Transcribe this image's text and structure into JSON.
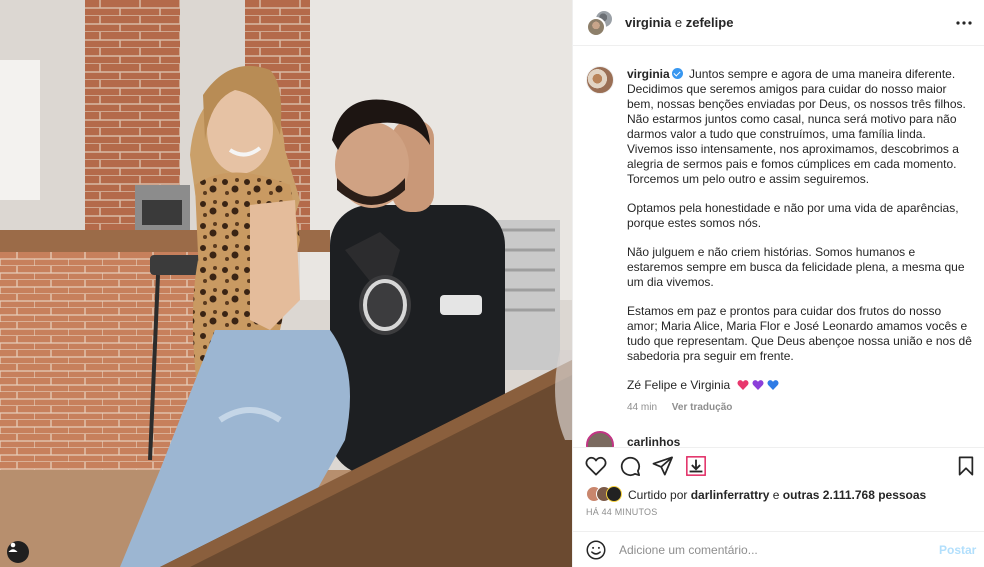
{
  "header": {
    "user1": "virginia",
    "conj": "e",
    "user2": "zefelipe"
  },
  "caption": {
    "username": "virginia",
    "paragraphs": [
      "Juntos sempre e agora de uma maneira diferente. Decidimos que seremos amigos para cuidar do nosso maior bem, nossas benções enviadas por Deus, os nossos três filhos. Não estarmos juntos como casal, nunca será motivo para não darmos valor a tudo que construímos, uma família linda. Vivemos isso intensamente, nos aproximamos, descobrimos a alegria de sermos pais e fomos cúmplices em cada momento. Torcemos um pelo outro e assim seguiremos.",
      "Optamos pela honestidade e não por uma vida de aparências, porque estes somos nós.",
      "Não julguem e não criem histórias. Somos humanos e estaremos sempre em busca da felicidade plena, a mesma que um dia vivemos.",
      "Estamos em paz e prontos para cuidar dos frutos do nosso amor; Maria Alice, Maria Flor e José Leonardo amamos vocês e tudo que representam. Que Deus abençoe nossa união e nos dê sabedoria pra seguir em frente.",
      "Zé Felipe e Virginia"
    ],
    "hearts": [
      {
        "name": "pink-heart-icon",
        "color": "#e8386d"
      },
      {
        "name": "purple-heart-icon",
        "color": "#8b3fd9"
      },
      {
        "name": "blue-heart-icon",
        "color": "#2f7be5"
      }
    ],
    "time": "44 min",
    "translate_label": "Ver tradução"
  },
  "next_comment": {
    "username": "carlinhos"
  },
  "likes": {
    "prefix": "Curtido por",
    "user": "darlinferrattry",
    "conj": "e",
    "others": "outras 2.111.768 pessoas"
  },
  "timestamp": "HÁ 44 MINUTOS",
  "comment_box": {
    "placeholder": "Adicione um comentário...",
    "post_label": "Postar"
  },
  "colors": {
    "accent": "#0095f6",
    "verified": "#3897f0",
    "post_disabled": "#b2dffc",
    "muted": "#8e8e8e"
  }
}
